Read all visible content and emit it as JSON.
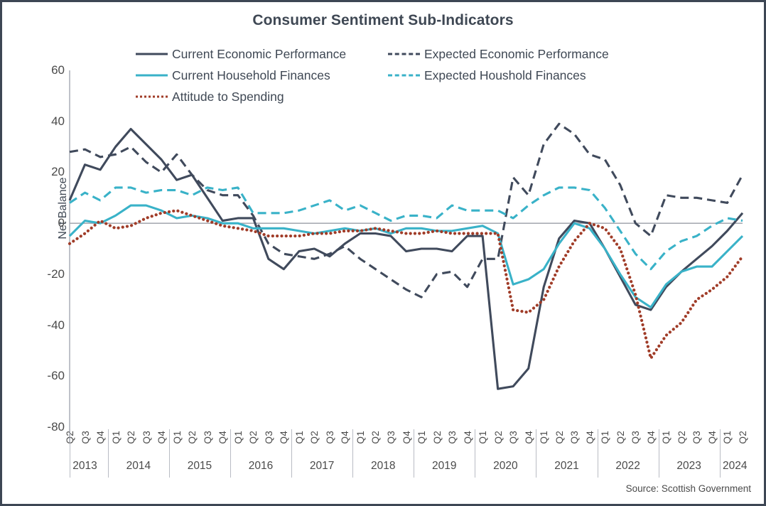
{
  "title": "Consumer Sentiment Sub-Indicators",
  "source": "Source: Scottish Government",
  "axis": {
    "ylabel": "Net Balance",
    "yticks": [
      "60",
      "40",
      "20",
      "0",
      "-20",
      "-40",
      "-60",
      "-80"
    ]
  },
  "legend": [
    {
      "label": "Current Economic Performance",
      "color": "#404a5c",
      "style": "solid"
    },
    {
      "label": "Expected Economic Performance",
      "color": "#404a5c",
      "style": "dashed"
    },
    {
      "label": "Current Household Finances",
      "color": "#39b2c8",
      "style": "solid"
    },
    {
      "label": "Expected Houshold Finances",
      "color": "#39b2c8",
      "style": "dashed"
    },
    {
      "label": "Attitude to Spending",
      "color": "#a03c28",
      "style": "dotted"
    }
  ],
  "chart_data": {
    "type": "line",
    "title": "Consumer Sentiment Sub-Indicators",
    "xlabel": "",
    "ylabel": "Net Balance",
    "ylim": [
      -80,
      60
    ],
    "ytick_step": 20,
    "grid": false,
    "legend_position": "top",
    "source": "Source: Scottish Government",
    "x": [
      "Q2 2013",
      "Q3 2013",
      "Q4 2013",
      "Q1 2014",
      "Q2 2014",
      "Q3 2014",
      "Q4 2014",
      "Q1 2015",
      "Q2 2015",
      "Q3 2015",
      "Q4 2015",
      "Q1 2016",
      "Q2 2016",
      "Q3 2016",
      "Q4 2016",
      "Q1 2017",
      "Q2 2017",
      "Q3 2017",
      "Q4 2017",
      "Q1 2018",
      "Q2 2018",
      "Q3 2018",
      "Q4 2018",
      "Q1 2019",
      "Q2 2019",
      "Q3 2019",
      "Q4 2019",
      "Q1 2020",
      "Q2 2020",
      "Q3 2020",
      "Q4 2020",
      "Q1 2021",
      "Q2 2021",
      "Q3 2021",
      "Q4 2021",
      "Q1 2022",
      "Q2 2022",
      "Q3 2022",
      "Q4 2022",
      "Q1 2023",
      "Q2 2023",
      "Q3 2023",
      "Q4 2023",
      "Q1 2024",
      "Q2 2024"
    ],
    "quarter_labels": [
      "Q2",
      "Q3",
      "Q4",
      "Q1",
      "Q2",
      "Q3",
      "Q4",
      "Q1",
      "Q2",
      "Q3",
      "Q4",
      "Q1",
      "Q2",
      "Q3",
      "Q4",
      "Q1",
      "Q2",
      "Q3",
      "Q4",
      "Q1",
      "Q2",
      "Q3",
      "Q4",
      "Q1",
      "Q2",
      "Q3",
      "Q4",
      "Q1",
      "Q2",
      "Q3",
      "Q4",
      "Q1",
      "Q2",
      "Q3",
      "Q4",
      "Q1",
      "Q2",
      "Q3",
      "Q4",
      "Q1",
      "Q2",
      "Q3",
      "Q4",
      "Q1",
      "Q2"
    ],
    "year_groups": [
      {
        "year": "2013",
        "count": 3
      },
      {
        "year": "2014",
        "count": 4
      },
      {
        "year": "2015",
        "count": 4
      },
      {
        "year": "2016",
        "count": 4
      },
      {
        "year": "2017",
        "count": 4
      },
      {
        "year": "2018",
        "count": 4
      },
      {
        "year": "2019",
        "count": 4
      },
      {
        "year": "2020",
        "count": 4
      },
      {
        "year": "2021",
        "count": 4
      },
      {
        "year": "2022",
        "count": 4
      },
      {
        "year": "2023",
        "count": 4
      },
      {
        "year": "2024",
        "count": 2
      }
    ],
    "series": [
      {
        "name": "Current Economic Performance",
        "color": "#404a5c",
        "style": "solid",
        "values": [
          9,
          23,
          21,
          30,
          37,
          31,
          25,
          17,
          19,
          10,
          1,
          2,
          2,
          -14,
          -18,
          -11,
          -10,
          -13,
          -8,
          -4,
          -4,
          -5,
          -11,
          -10,
          -10,
          -11,
          -5,
          -5,
          -65,
          -64,
          -57,
          -25,
          -6,
          1,
          0,
          -10,
          -21,
          -32,
          -34,
          -25,
          -19,
          -14,
          -9,
          -3,
          4
        ]
      },
      {
        "name": "Expected Economic Performance",
        "color": "#404a5c",
        "style": "dashed",
        "values": [
          28,
          29,
          26,
          27,
          30,
          24,
          20,
          27,
          19,
          13,
          11,
          11,
          3,
          -8,
          -12,
          -13,
          -14,
          -12,
          -9,
          -14,
          -18,
          -22,
          -26,
          -29,
          -20,
          -19,
          -25,
          -14,
          -14,
          18,
          11,
          31,
          39,
          35,
          27,
          25,
          15,
          0,
          -5,
          11,
          10,
          10,
          9,
          8,
          19
        ]
      },
      {
        "name": "Current Household Finances",
        "color": "#39b2c8",
        "style": "solid",
        "values": [
          -5,
          1,
          0,
          3,
          7,
          7,
          5,
          2,
          3,
          2,
          0,
          0,
          -2,
          -2,
          -2,
          -3,
          -4,
          -3,
          -2,
          -3,
          -2,
          -4,
          -2,
          -2,
          -3,
          -3,
          -2,
          -1,
          -4,
          -24,
          -22,
          -18,
          -8,
          0,
          -2,
          -10,
          -20,
          -29,
          -33,
          -24,
          -19,
          -17,
          -17,
          -11,
          -5
        ]
      },
      {
        "name": "Expected Houshold Finances",
        "color": "#39b2c8",
        "style": "dashed",
        "values": [
          8,
          12,
          9,
          14,
          14,
          12,
          13,
          13,
          11,
          14,
          13,
          14,
          4,
          4,
          4,
          5,
          7,
          9,
          5,
          7,
          4,
          1,
          3,
          3,
          2,
          7,
          5,
          5,
          5,
          2,
          7,
          11,
          14,
          14,
          13,
          6,
          -3,
          -12,
          -18,
          -11,
          -7,
          -5,
          -1,
          2,
          1
        ]
      },
      {
        "name": "Attitude to Spending",
        "color": "#a03c28",
        "style": "dotted",
        "values": [
          -8,
          -4,
          1,
          -2,
          -1,
          2,
          4,
          5,
          3,
          1,
          -1,
          -2,
          -3,
          -5,
          -5,
          -5,
          -4,
          -4,
          -3,
          -3,
          -2,
          -3,
          -4,
          -4,
          -3,
          -4,
          -4,
          -4,
          -4,
          -34,
          -35,
          -30,
          -17,
          -7,
          0,
          -2,
          -10,
          -28,
          -53,
          -44,
          -39,
          -30,
          -26,
          -21,
          -13
        ]
      }
    ]
  }
}
